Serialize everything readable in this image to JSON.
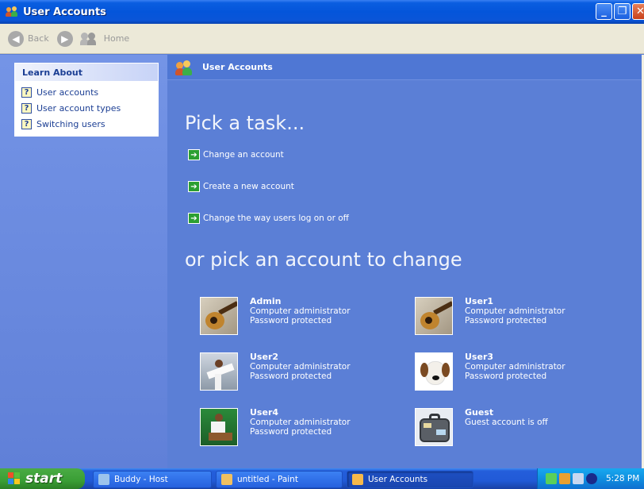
{
  "window": {
    "title": "User Accounts"
  },
  "toolbar": {
    "back_label": "Back",
    "home_label": "Home"
  },
  "learn_about": {
    "header": "Learn About",
    "items": [
      {
        "label": "User accounts"
      },
      {
        "label": "User account types"
      },
      {
        "label": "Switching users"
      }
    ]
  },
  "main": {
    "header_title": "User Accounts",
    "pick_task_heading": "Pick a task...",
    "tasks": [
      {
        "label": "Change an account"
      },
      {
        "label": "Create a new account"
      },
      {
        "label": "Change the way users log on or off"
      }
    ],
    "pick_account_heading": "or pick an account to change",
    "accounts": [
      {
        "name": "Admin",
        "type": "Computer administrator",
        "status": "Password protected",
        "picture": "guitar-icon"
      },
      {
        "name": "User1",
        "type": "Computer administrator",
        "status": "Password protected",
        "picture": "guitar-icon"
      },
      {
        "name": "User2",
        "type": "Computer administrator",
        "status": "Password protected",
        "picture": "karate-icon"
      },
      {
        "name": "User3",
        "type": "Computer administrator",
        "status": "Password protected",
        "picture": "dog-icon"
      },
      {
        "name": "User4",
        "type": "Computer administrator",
        "status": "Password protected",
        "picture": "soccer-icon"
      },
      {
        "name": "Guest",
        "type": "Guest account is off",
        "status": "",
        "picture": "suitcase-icon"
      }
    ]
  },
  "taskbar": {
    "start_label": "start",
    "buttons": [
      {
        "label": "Buddy - Host"
      },
      {
        "label": "untitled - Paint"
      },
      {
        "label": "User Accounts"
      }
    ],
    "clock": "5:28 PM"
  }
}
